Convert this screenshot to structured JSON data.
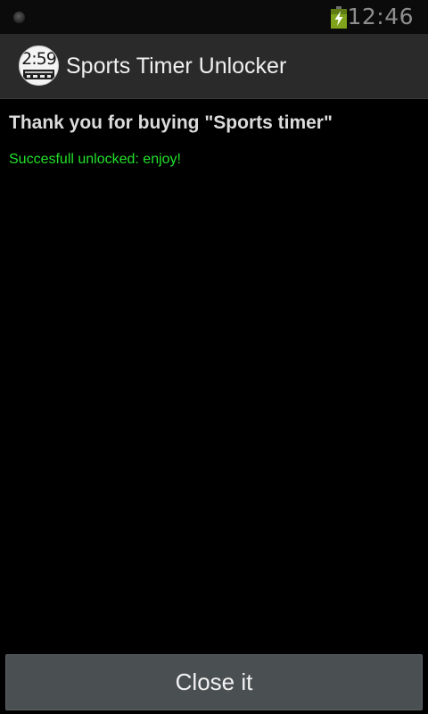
{
  "status_bar": {
    "time": "12:46",
    "battery_icon": "battery-charging-icon",
    "notification_icon": "notification-dot-icon",
    "battery_color": "#7fa31a"
  },
  "action_bar": {
    "title": "Sports Timer Unlocker",
    "icon_time": "2:59",
    "icon_name": "sports-timer-app-icon"
  },
  "content": {
    "thanks": "Thank you for buying \"Sports timer\"",
    "success": "Succesfull unlocked: enjoy!",
    "success_color": "#22e02a"
  },
  "footer": {
    "close_label": "Close it"
  }
}
